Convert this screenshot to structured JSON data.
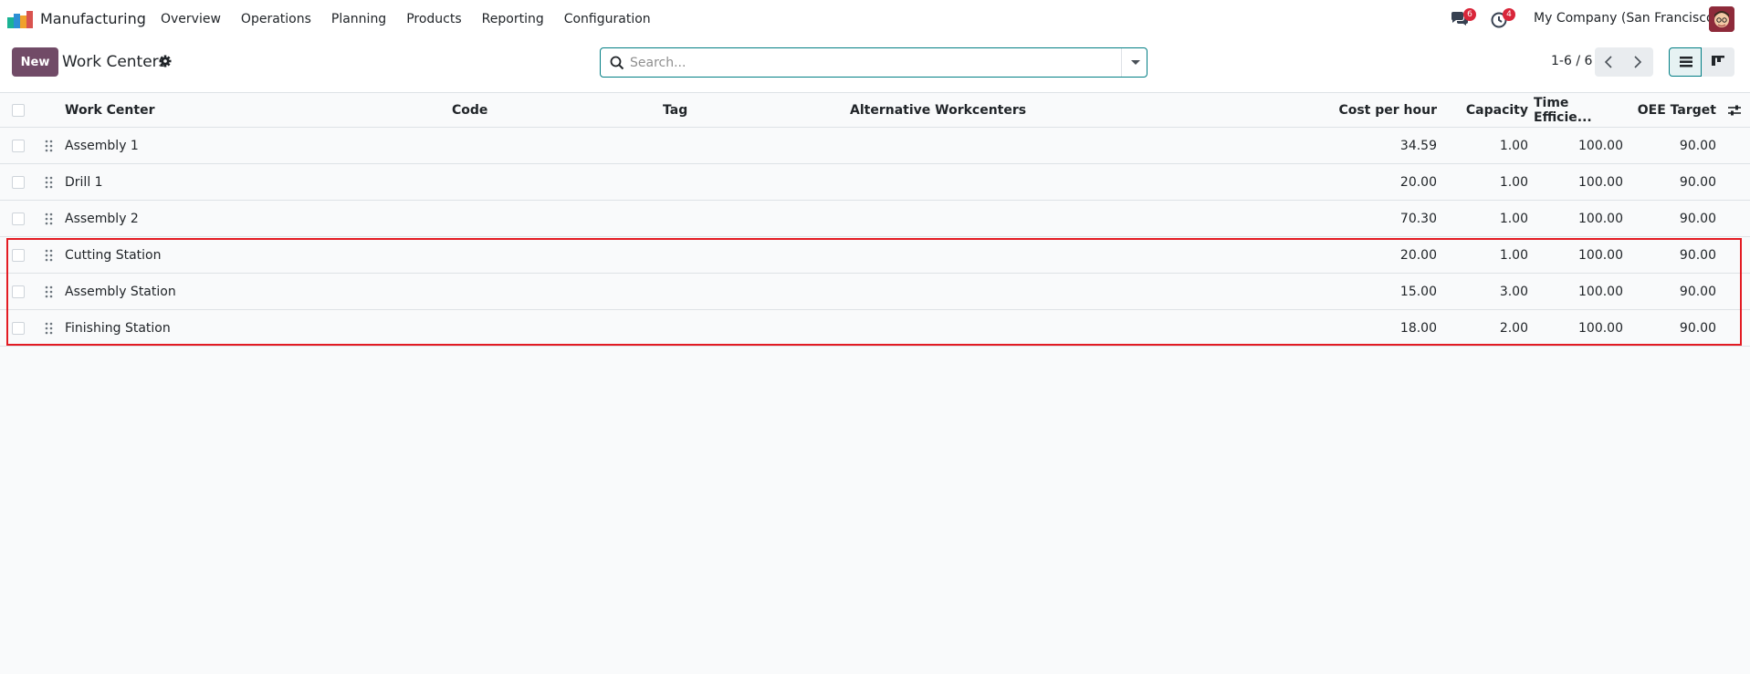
{
  "navbar": {
    "app_name": "Manufacturing",
    "menu": [
      "Overview",
      "Operations",
      "Planning",
      "Products",
      "Reporting",
      "Configuration"
    ],
    "messages_count": "6",
    "activities_count": "4",
    "company": "My Company (San Francisco)"
  },
  "control": {
    "new_label": "New",
    "title": "Work Centers",
    "search_placeholder": "Search...",
    "pager": "1-6 / 6"
  },
  "table": {
    "headers": {
      "name": "Work Center",
      "code": "Code",
      "tag": "Tag",
      "alternative": "Alternative Workcenters",
      "cost": "Cost per hour",
      "capacity": "Capacity",
      "efficiency": "Time Efficie...",
      "oee": "OEE Target"
    },
    "rows": [
      {
        "name": "Assembly 1",
        "code": "",
        "tag": "",
        "alternative": "",
        "cost": "34.59",
        "capacity": "1.00",
        "efficiency": "100.00",
        "oee": "90.00"
      },
      {
        "name": "Drill 1",
        "code": "",
        "tag": "",
        "alternative": "",
        "cost": "20.00",
        "capacity": "1.00",
        "efficiency": "100.00",
        "oee": "90.00"
      },
      {
        "name": "Assembly 2",
        "code": "",
        "tag": "",
        "alternative": "",
        "cost": "70.30",
        "capacity": "1.00",
        "efficiency": "100.00",
        "oee": "90.00"
      },
      {
        "name": "Cutting Station",
        "code": "",
        "tag": "",
        "alternative": "",
        "cost": "20.00",
        "capacity": "1.00",
        "efficiency": "100.00",
        "oee": "90.00"
      },
      {
        "name": "Assembly Station",
        "code": "",
        "tag": "",
        "alternative": "",
        "cost": "15.00",
        "capacity": "3.00",
        "efficiency": "100.00",
        "oee": "90.00"
      },
      {
        "name": "Finishing Station",
        "code": "",
        "tag": "",
        "alternative": "",
        "cost": "18.00",
        "capacity": "2.00",
        "efficiency": "100.00",
        "oee": "90.00"
      }
    ]
  },
  "colors": {
    "brand": "#714b67",
    "accent": "#017e84",
    "badge": "#d9263a",
    "highlight": "#e31b23"
  },
  "icons": [
    "app-logo-icon",
    "chat-icon",
    "activity-clock-icon",
    "avatar",
    "gear-icon",
    "search-icon",
    "chevron-down-icon",
    "chevron-left-icon",
    "chevron-right-icon",
    "list-view-icon",
    "kanban-view-icon",
    "drag-handle-icon",
    "optional-columns-icon"
  ]
}
